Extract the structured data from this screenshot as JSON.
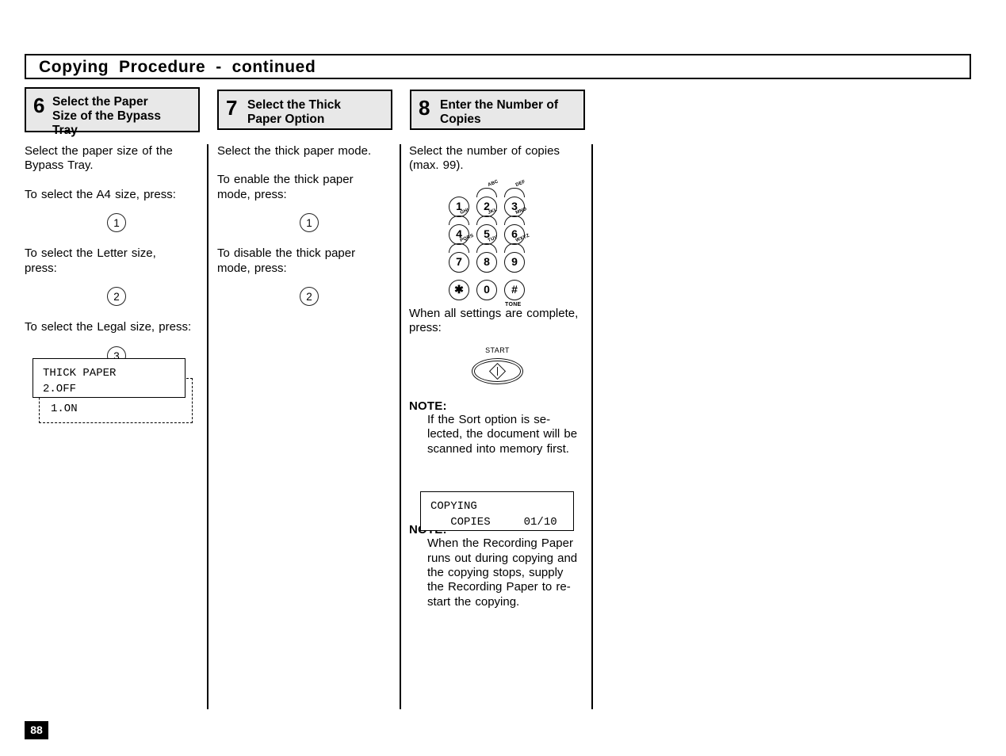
{
  "header": {
    "title": "Copying  Procedure  -  continued"
  },
  "steps": [
    {
      "number": "6",
      "title": "Select the Paper\nSize of the Bypass\nTray"
    },
    {
      "number": "7",
      "title": "Select the Thick\nPaper Option"
    },
    {
      "number": "8",
      "title": "Enter the Number of\nCopies"
    }
  ],
  "column1": {
    "intro": "Select the paper size of the\nBypass  Tray.",
    "a4_prompt": "To  select  the  A4  size,  press:",
    "a4_key": "1",
    "letter_prompt": "To  select  the  Letter  size,\npress:",
    "letter_key": "2",
    "legal_prompt": "To  select  the  Legal  size,  press:",
    "legal_key": "3",
    "lcd": {
      "line1": "THICK PAPER",
      "line2": "2.OFF",
      "dashed_line": "1.ON"
    }
  },
  "column2": {
    "intro": "Select the thick paper mode.",
    "enable_prompt": "To  enable  the  thick  paper\nmode,  press:",
    "enable_key": "1",
    "disable_prompt": "To  disable  the  thick  paper\nmode,  press:",
    "disable_key": "2"
  },
  "column3": {
    "intro": "Select the number of copies\n(max. 99).",
    "keypad": {
      "keys": [
        {
          "digit": "1",
          "letters": ""
        },
        {
          "digit": "2",
          "letters": "ABC"
        },
        {
          "digit": "3",
          "letters": "DEF"
        },
        {
          "digit": "4",
          "letters": "GHI"
        },
        {
          "digit": "5",
          "letters": "JKL"
        },
        {
          "digit": "6",
          "letters": "MNO"
        },
        {
          "digit": "7",
          "letters": "PQRS"
        },
        {
          "digit": "8",
          "letters": "TUV"
        },
        {
          "digit": "9",
          "letters": "WXYZ"
        },
        {
          "digit": "✱",
          "letters": ""
        },
        {
          "digit": "0",
          "letters": ""
        },
        {
          "digit": "#",
          "letters": ""
        }
      ],
      "tone_label": "TONE"
    },
    "complete_prompt": "When all settings are complete,\npress:",
    "start_label": "START",
    "note1": {
      "title": "NOTE:",
      "body": "If the Sort option is se-\nlected, the document will be\nscanned into memory first."
    },
    "lcd": {
      "line1": "COPYING",
      "line2": "   COPIES     01/10"
    },
    "note2": {
      "title": "NOTE:",
      "body": "When the Recording Paper\nruns out during copying and\nthe  copying  stops,  supply\nthe Recording Paper to re-\nstart  the  copying."
    }
  },
  "footer": {
    "page_number": "88"
  }
}
